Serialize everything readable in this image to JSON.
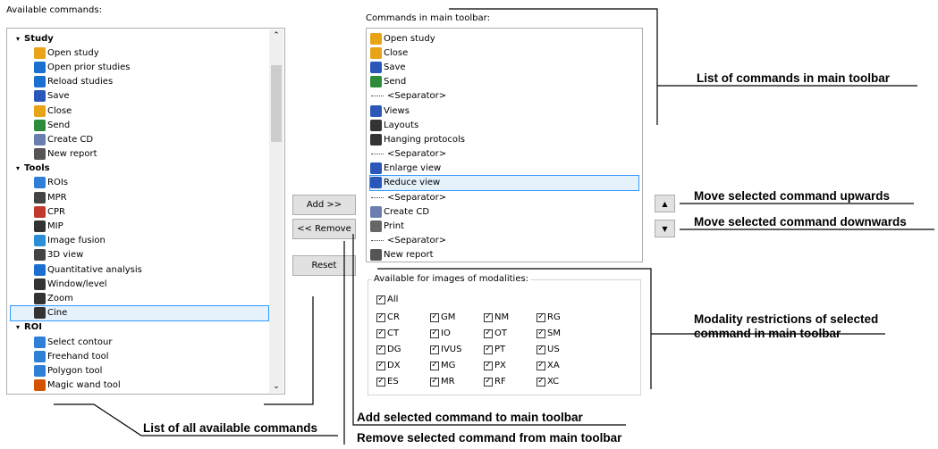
{
  "left_panel": {
    "title": "Available commands:",
    "items": [
      {
        "type": "group",
        "label": "Study"
      },
      {
        "type": "item",
        "label": "Open study",
        "icon": "folder-open-icon",
        "color": "#e8a317"
      },
      {
        "type": "item",
        "label": "Open prior studies",
        "icon": "prior-studies-icon",
        "color": "#1a6fd1"
      },
      {
        "type": "item",
        "label": "Reload studies",
        "icon": "reload-icon",
        "color": "#1a6fd1"
      },
      {
        "type": "item",
        "label": "Save",
        "icon": "save-icon",
        "color": "#2b57b8"
      },
      {
        "type": "item",
        "label": "Close",
        "icon": "close-folder-icon",
        "color": "#e8a317"
      },
      {
        "type": "item",
        "label": "Send",
        "icon": "send-icon",
        "color": "#2e8b3a"
      },
      {
        "type": "item",
        "label": "Create CD",
        "icon": "cd-icon",
        "color": "#6a7fb0"
      },
      {
        "type": "item",
        "label": "New report",
        "icon": "report-icon",
        "color": "#555555"
      },
      {
        "type": "group",
        "label": "Tools"
      },
      {
        "type": "item",
        "label": "ROIs",
        "icon": "roi-icon",
        "color": "#2f7fd6"
      },
      {
        "type": "item",
        "label": "MPR",
        "icon": "mpr-icon",
        "color": "#444444"
      },
      {
        "type": "item",
        "label": "CPR",
        "icon": "cpr-icon",
        "color": "#c0392b"
      },
      {
        "type": "item",
        "label": "MIP",
        "icon": "mip-icon",
        "color": "#333333"
      },
      {
        "type": "item",
        "label": "Image fusion",
        "icon": "image-fusion-icon",
        "color": "#2a8fd6"
      },
      {
        "type": "item",
        "label": "3D view",
        "icon": "cube-icon",
        "color": "#444444"
      },
      {
        "type": "item",
        "label": "Quantitative analysis",
        "icon": "graph-icon",
        "color": "#1a6fd1"
      },
      {
        "type": "item",
        "label": "Window/level",
        "icon": "window-level-icon",
        "color": "#333333"
      },
      {
        "type": "item",
        "label": "Zoom",
        "icon": "magnifier-icon",
        "color": "#333333"
      },
      {
        "type": "item",
        "label": "Cine",
        "icon": "cine-icon",
        "color": "#333333",
        "selected": true
      },
      {
        "type": "group",
        "label": "ROI"
      },
      {
        "type": "item",
        "label": "Select contour",
        "icon": "select-contour-icon",
        "color": "#2f7fd6"
      },
      {
        "type": "item",
        "label": "Freehand tool",
        "icon": "freehand-icon",
        "color": "#2f7fd6"
      },
      {
        "type": "item",
        "label": "Polygon tool",
        "icon": "polygon-icon",
        "color": "#2f7fd6"
      },
      {
        "type": "item",
        "label": "Magic wand tool",
        "icon": "magic-wand-icon",
        "color": "#d35400"
      }
    ]
  },
  "buttons": {
    "add": "Add >>",
    "remove": "<< Remove",
    "reset": "Reset"
  },
  "right_panel": {
    "title": "Commands in main toolbar:",
    "items": [
      {
        "label": "Open study",
        "icon": "folder-open-icon",
        "color": "#e8a317"
      },
      {
        "label": "Close",
        "icon": "close-folder-icon",
        "color": "#e8a317"
      },
      {
        "label": "Save",
        "icon": "save-icon",
        "color": "#2b57b8"
      },
      {
        "label": "Send",
        "icon": "send-icon",
        "color": "#2e8b3a"
      },
      {
        "label": "<Separator>",
        "separator": true
      },
      {
        "label": "Views",
        "icon": "views-icon",
        "color": "#2b57b8"
      },
      {
        "label": "Layouts",
        "icon": "layouts-icon",
        "color": "#333333"
      },
      {
        "label": "Hanging protocols",
        "icon": "hanging-protocols-icon",
        "color": "#333333"
      },
      {
        "label": "<Separator>",
        "separator": true
      },
      {
        "label": "Enlarge view",
        "icon": "enlarge-view-icon",
        "color": "#2b57b8"
      },
      {
        "label": "Reduce view",
        "icon": "reduce-view-icon",
        "color": "#2b57b8",
        "selected": true
      },
      {
        "label": "<Separator>",
        "separator": true
      },
      {
        "label": "Create CD",
        "icon": "cd-icon",
        "color": "#6a7fb0"
      },
      {
        "label": "Print",
        "icon": "printer-icon",
        "color": "#666666"
      },
      {
        "label": "<Separator>",
        "separator": true
      },
      {
        "label": "New report",
        "icon": "report-icon",
        "color": "#555555"
      }
    ]
  },
  "modalities": {
    "title": "Available for images of modalities:",
    "all_label": "All",
    "columns": [
      [
        "CR",
        "CT",
        "DG",
        "DX",
        "ES"
      ],
      [
        "GM",
        "IO",
        "IVUS",
        "MG",
        "MR"
      ],
      [
        "NM",
        "OT",
        "PT",
        "PX",
        "RF"
      ],
      [
        "RG",
        "SM",
        "US",
        "XA",
        "XC"
      ]
    ]
  },
  "annotations": {
    "list_main_toolbar": "List of commands in main toolbar",
    "move_up": "Move selected command upwards",
    "move_down": "Move selected command downwards",
    "modality_line1": "Modality restrictions of selected",
    "modality_line2": "command in main toolbar",
    "list_all": "List of all available commands",
    "add_cmd": "Add selected command to main toolbar",
    "remove_cmd": "Remove selected command from main toolbar"
  }
}
